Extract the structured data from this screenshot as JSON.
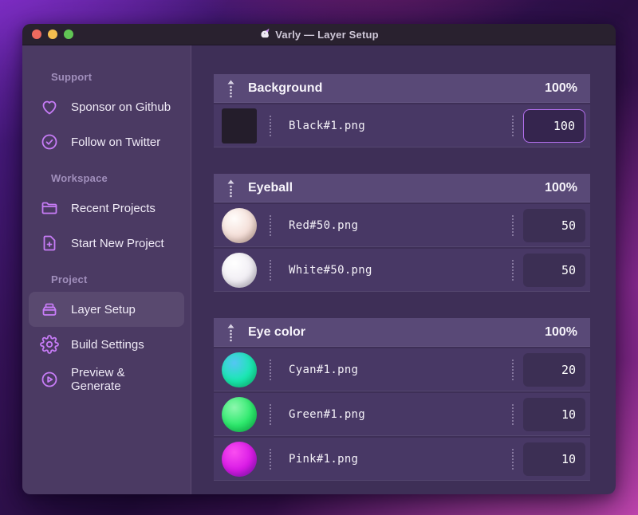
{
  "window": {
    "title": "Varly — Layer Setup",
    "app_icon": "unicorn-icon",
    "traffic_lights": [
      {
        "name": "close",
        "color": "#ee6a5f"
      },
      {
        "name": "minimize",
        "color": "#f5bd4f"
      },
      {
        "name": "zoom",
        "color": "#61c554"
      }
    ]
  },
  "colors": {
    "accent_purple": "#c77cf7",
    "focused_input_border": "#b470ef",
    "sidebar_bg": "#4b3a63",
    "main_bg": "#3e2f57",
    "group_header_bg": "#594977",
    "row_bg": "#483865"
  },
  "sidebar": {
    "sections": [
      {
        "label": "Support",
        "items": [
          {
            "icon": "heart-icon",
            "label": "Sponsor on Github",
            "selected": false
          },
          {
            "icon": "badge-check-icon",
            "label": "Follow on Twitter",
            "selected": false
          }
        ]
      },
      {
        "label": "Workspace",
        "items": [
          {
            "icon": "folder-icon",
            "label": "Recent Projects",
            "selected": false
          },
          {
            "icon": "file-plus-icon",
            "label": "Start New Project",
            "selected": false
          }
        ]
      },
      {
        "label": "Project",
        "items": [
          {
            "icon": "layers-box-icon",
            "label": "Layer Setup",
            "selected": true
          },
          {
            "icon": "gear-icon",
            "label": "Build Settings",
            "selected": false
          },
          {
            "icon": "play-circle-icon",
            "label": "Preview & Generate",
            "selected": false
          }
        ]
      }
    ]
  },
  "main": {
    "groups": [
      {
        "name": "Background",
        "weight": "100%",
        "rows": [
          {
            "thumb": {
              "shape": "square",
              "colors": [
                "#241d2b",
                "#241d2b",
                "#241d2b"
              ]
            },
            "filename": "Black#1.png",
            "value": "100",
            "focused": true
          }
        ]
      },
      {
        "name": "Eyeball",
        "weight": "100%",
        "rows": [
          {
            "thumb": {
              "shape": "sphere",
              "colors": [
                "#fffdfb",
                "#f4ded7",
                "#d6b2a5"
              ]
            },
            "filename": "Red#50.png",
            "value": "50",
            "focused": false
          },
          {
            "thumb": {
              "shape": "sphere",
              "colors": [
                "#ffffff",
                "#f1eef4",
                "#ccc5d7"
              ]
            },
            "filename": "White#50.png",
            "value": "50",
            "focused": false
          }
        ]
      },
      {
        "name": "Eye color",
        "weight": "100%",
        "rows": [
          {
            "thumb": {
              "shape": "sphere",
              "colors": [
                "#54c6f4",
                "#19e9b0",
                "#12e089"
              ]
            },
            "filename": "Cyan#1.png",
            "value": "20",
            "focused": false
          },
          {
            "thumb": {
              "shape": "sphere",
              "colors": [
                "#8df7ae",
                "#2cea6c",
                "#0fd158"
              ]
            },
            "filename": "Green#1.png",
            "value": "10",
            "focused": false
          },
          {
            "thumb": {
              "shape": "sphere",
              "colors": [
                "#fa4df0",
                "#d81ae6",
                "#9815d4"
              ]
            },
            "filename": "Pink#1.png",
            "value": "10",
            "focused": false
          }
        ]
      }
    ]
  }
}
